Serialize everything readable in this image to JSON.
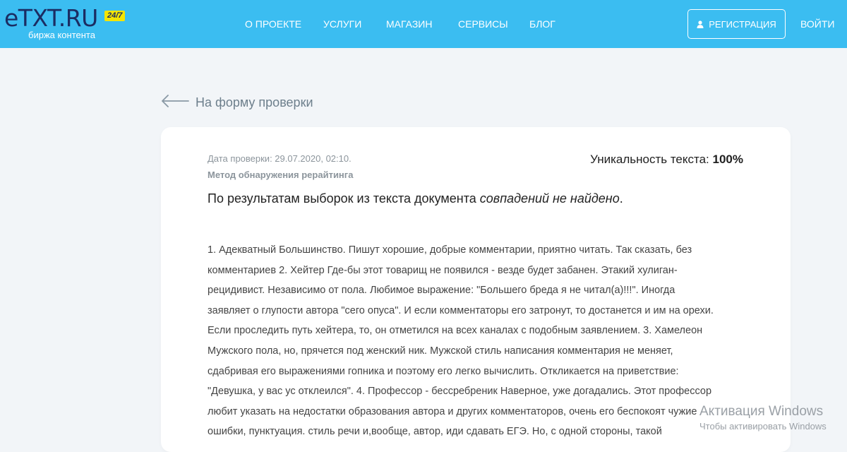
{
  "header": {
    "logo_text": "eTXT.RU",
    "logo_badge": "24/7",
    "logo_subtitle": "биржа контента",
    "nav": [
      {
        "label": "О ПРОЕКТЕ"
      },
      {
        "label": "УСЛУГИ"
      },
      {
        "label": "МАГАЗИН"
      },
      {
        "label": "СЕРВИСЫ"
      },
      {
        "label": "БЛОГ"
      }
    ],
    "register_label": "РЕГИСТРАЦИЯ",
    "register_icon": "user-icon",
    "login_label": "ВОЙТИ",
    "colors": {
      "bar": "#3bbdf1",
      "logo": "#1b2d63",
      "badge": "#f5e500"
    }
  },
  "back": {
    "label": "На форму проверки",
    "icon": "arrow-left-icon"
  },
  "report": {
    "date": "Дата проверки: 29.07.2020, 02:10.",
    "method": "Метод обнаружения рерайтинга",
    "uniqueness_label": "Уникальность текста:",
    "uniqueness_value": "100%",
    "result_prefix": "По результатам выборок из текста документа ",
    "result_emphasis": "совпадений не найдено",
    "result_suffix": ".",
    "text_lines": [
      "1. Адекватный Большинство. Пишут хорошие, добрые комментарии, приятно читать. Так сказать, без",
      "комментариев 2. Хейтер Где-бы этот товарищ не появился - везде будет забанен. Этакий хулиган-",
      "рецидивист. Независимо от пола. Любимое выражение: \"Большего бреда я не читал(а)!!!\". Иногда",
      "заявляет о глупости автора \"сего опуса\". И если комментаторы его затронут, то достанется и им на орехи.",
      "Если проследить путь хейтера, то, он отметился на всех каналах с подобным заявлением. 3. Хамелеон",
      "Мужского пола, но, прячется под женский ник. Мужской стиль написания комментария не меняет,",
      "сдабривая его выражениями гопника и поэтому его легко вычислить. Откликается на приветствие:",
      "\"Девушка, у вас ус отклеился\". 4. Профессор - бессребреник Наверное, уже догадались. Этот профессор",
      "любит указать на недостатки образования автора и других комментаторов, очень его беспокоят чужие",
      "ошибки, пунктуация. стиль речи и,вообще, автор, иди сдавать ЕГЭ. Но, с одной стороны, такой"
    ]
  },
  "watermark": {
    "title": "Активация Windows",
    "subtitle": "Чтобы активировать Windows"
  }
}
